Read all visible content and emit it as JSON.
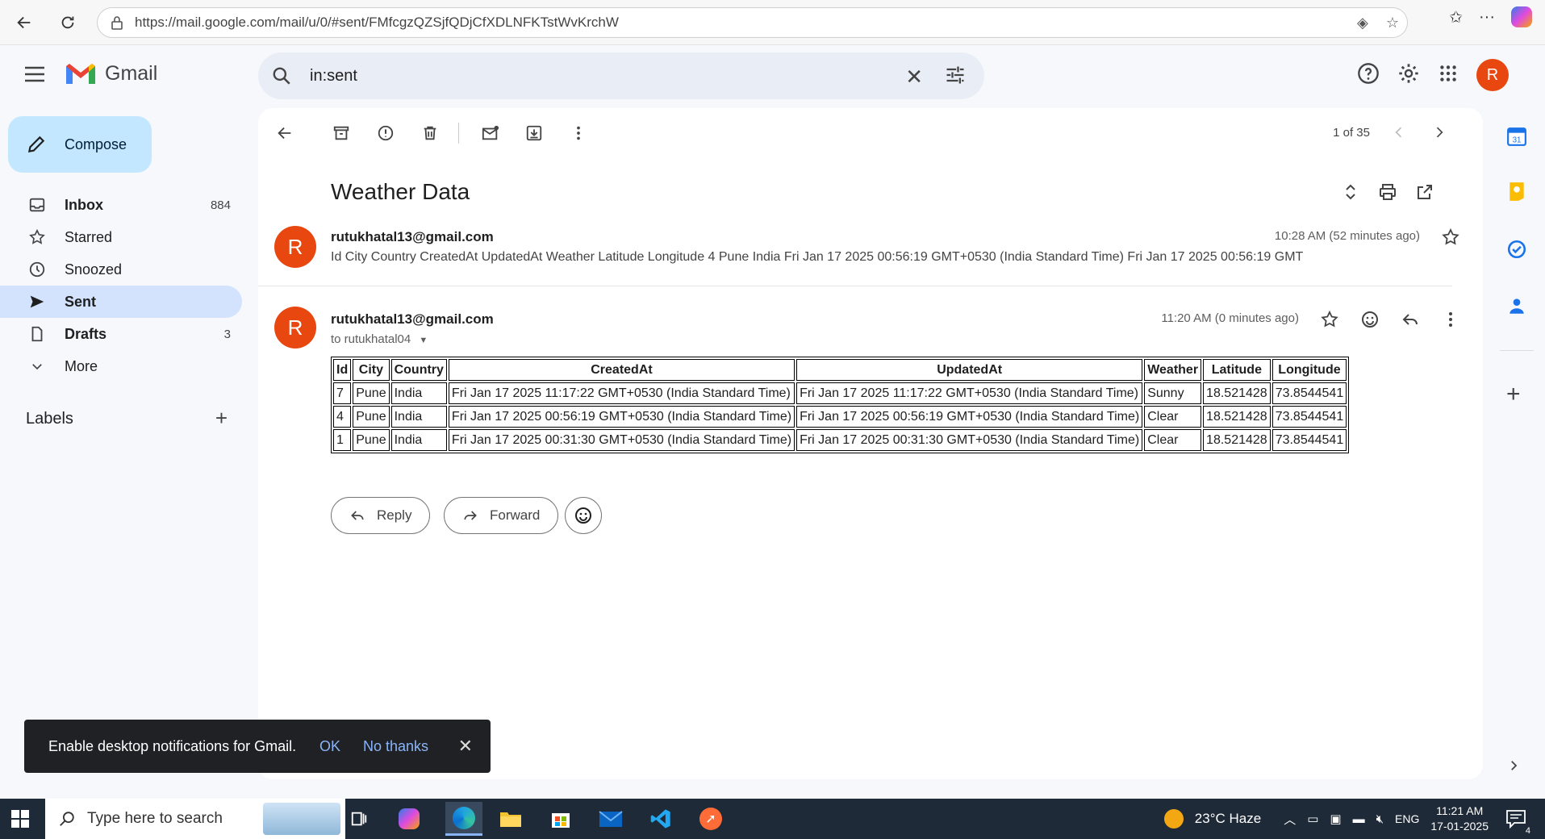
{
  "browser": {
    "url": "https://mail.google.com/mail/u/0/#sent/FMfcgzQZSjfQDjCfXDLNFKTstWvKrchW"
  },
  "gmail": {
    "logo_text": "Gmail",
    "search_value": "in:sent",
    "avatar_letter": "R"
  },
  "sidebar": {
    "compose_label": "Compose",
    "items": [
      {
        "label": "Inbox",
        "count": "884"
      },
      {
        "label": "Starred",
        "count": ""
      },
      {
        "label": "Snoozed",
        "count": ""
      },
      {
        "label": "Sent",
        "count": ""
      },
      {
        "label": "Drafts",
        "count": "3"
      },
      {
        "label": "More",
        "count": ""
      }
    ],
    "labels_heading": "Labels"
  },
  "toolbar": {
    "pager_text": "1 of 35"
  },
  "thread": {
    "subject": "Weather Data",
    "messages": [
      {
        "avatar": "R",
        "sender": "rutukhatal13@gmail.com",
        "time": "10:28 AM (52 minutes ago)",
        "snippet": "Id City Country CreatedAt UpdatedAt Weather Latitude Longitude 4 Pune India Fri Jan 17 2025 00:56:19 GMT+0530 (India Standard Time) Fri Jan 17 2025 00:56:19 GMT"
      },
      {
        "avatar": "R",
        "sender": "rutukhatal13@gmail.com",
        "time": "11:20 AM (0 minutes ago)",
        "to_line": "to rutukhatal04"
      }
    ],
    "table": {
      "headers": [
        "Id",
        "City",
        "Country",
        "CreatedAt",
        "UpdatedAt",
        "Weather",
        "Latitude",
        "Longitude"
      ],
      "rows": [
        [
          "7",
          "Pune",
          "India",
          "Fri Jan 17 2025 11:17:22 GMT+0530 (India Standard Time)",
          "Fri Jan 17 2025 11:17:22 GMT+0530 (India Standard Time)",
          "Sunny",
          "18.521428",
          "73.8544541"
        ],
        [
          "4",
          "Pune",
          "India",
          "Fri Jan 17 2025 00:56:19 GMT+0530 (India Standard Time)",
          "Fri Jan 17 2025 00:56:19 GMT+0530 (India Standard Time)",
          "Clear",
          "18.521428",
          "73.8544541"
        ],
        [
          "1",
          "Pune",
          "India",
          "Fri Jan 17 2025 00:31:30 GMT+0530 (India Standard Time)",
          "Fri Jan 17 2025 00:31:30 GMT+0530 (India Standard Time)",
          "Clear",
          "18.521428",
          "73.8544541"
        ]
      ]
    },
    "reply_label": "Reply",
    "forward_label": "Forward"
  },
  "toast": {
    "message": "Enable desktop notifications for Gmail.",
    "ok": "OK",
    "no_thanks": "No thanks"
  },
  "taskbar": {
    "search_placeholder": "Type here to search",
    "weather": "23°C  Haze",
    "lang": "ENG",
    "time": "11:21 AM",
    "date": "17-01-2025",
    "notif_count": "4"
  },
  "colors": {
    "accent": "#0b57d0",
    "compose_bg": "#c2e7ff",
    "active_nav": "#d3e3fd",
    "avatar": "#e8470f"
  }
}
